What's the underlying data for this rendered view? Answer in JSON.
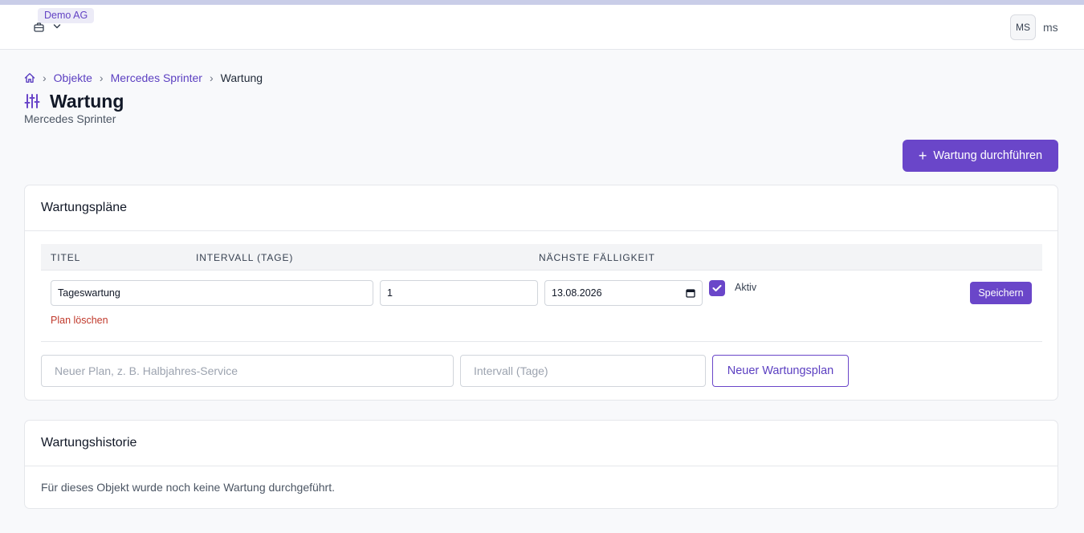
{
  "header": {
    "org_name": "Demo AG",
    "user_initials": "MS",
    "username": "ms"
  },
  "breadcrumb": {
    "items": [
      "Objekte",
      "Mercedes Sprinter"
    ],
    "current": "Wartung",
    "separator": "›"
  },
  "page": {
    "title": "Wartung",
    "subtitle": "Mercedes Sprinter",
    "primary_action": "Wartung durchführen",
    "primary_action_icon": "+"
  },
  "plans": {
    "title": "Wartungspläne",
    "columns": [
      "TITEL",
      "INTERVALL (TAGE)",
      "NÄCHSTE FÄLLIGKEIT"
    ],
    "rows": [
      {
        "title": "Tageswartung",
        "interval": "1",
        "next_due": "13.08.2026",
        "active": true,
        "active_label": "Aktiv",
        "save_label": "Speichern",
        "delete_label": "Plan löschen"
      }
    ],
    "new_plan": {
      "name_placeholder": "Neuer Plan, z. B. Halbjahres-Service",
      "interval_placeholder": "Intervall (Tage)",
      "button_label": "Neuer Wartungsplan"
    }
  },
  "history": {
    "title": "Wartungshistorie",
    "empty_text": "Für dieses Objekt wurde noch keine Wartung durchgeführt."
  },
  "colors": {
    "accent": "#6a46c9",
    "link": "#5b3fc1",
    "danger": "#c0392b",
    "badge_bg": "#ecebf7"
  }
}
